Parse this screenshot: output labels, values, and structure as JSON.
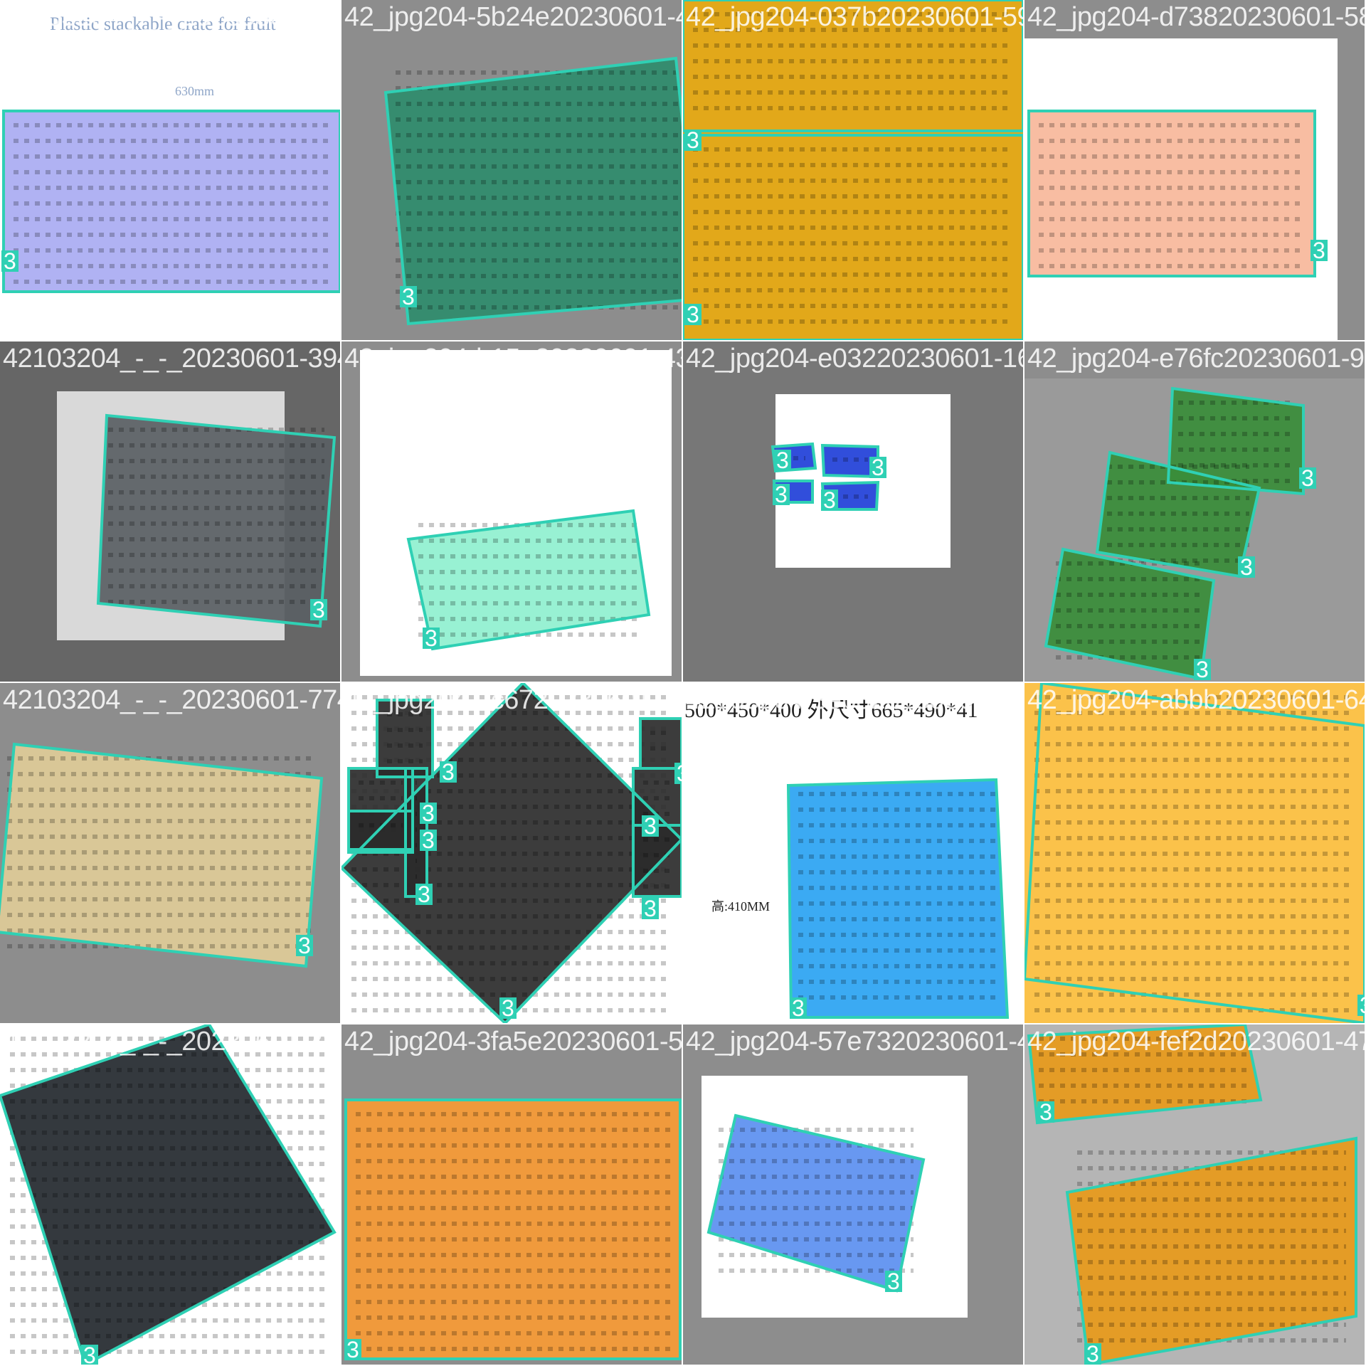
{
  "grid": {
    "rows": 4,
    "cols": 4
  },
  "box_color": "#2fd0b4",
  "tiles": [
    {
      "filename": "42103204_-_-_20230601-1042103204-15b24e",
      "caption": "Plastic stackable crate for fruit",
      "dim": "630mm",
      "crate_color": "#a9abf2",
      "bg": "#ffffff",
      "labels": [
        "3"
      ]
    },
    {
      "filename": "42_jpg204-5b24e20230601-4642103204-037b",
      "crate_color": "#2f8c6d",
      "bg": "#8d8d8d",
      "labels": [
        "3"
      ]
    },
    {
      "filename": "42_jpg204-037b20230601-5942103204-d738",
      "crate_color": "#e2a81a",
      "bg": "#e2a81a",
      "labels": [
        "3",
        "3"
      ]
    },
    {
      "filename": "42_jpg204-d73820230601-58",
      "crate_color": "#f7b79a",
      "bg": "#8d8d8d",
      "labels": [
        "3"
      ]
    },
    {
      "filename": "42103204_-_-_20230601-3942103204-b15e",
      "crate_color": "#5a6064",
      "bg": "#666666",
      "labels": [
        "3"
      ]
    },
    {
      "filename": "42_jpg204-b15e20230601-4342103204-e032",
      "crate_color": "#8ff0cf",
      "bg": "#8d8d8d",
      "labels": [
        "3"
      ]
    },
    {
      "filename": "42_jpg204-e03220230601-1642103204-e76fc",
      "crate_color": "#1f3fd8",
      "bg": "#777777",
      "labels": [
        "3",
        "3",
        "3",
        "3"
      ]
    },
    {
      "filename": "42_jpg204-e76fc20230601-93",
      "crate_color": "#3a8d3a",
      "bg": "#8d8d8d",
      "labels": [
        "3",
        "3",
        "3"
      ]
    },
    {
      "filename": "42103204_-_-_20230601-7742103204-2c67",
      "crate_color": "#e0cc98",
      "bg": "#8d8d8d",
      "labels": [
        "3"
      ]
    },
    {
      "filename": "42_jpg204-2c6720230601-1042103204-3eb8",
      "crate_color": "#2b2b2b",
      "bg": "#ffffff",
      "labels": [
        "3",
        "3",
        "3",
        "3",
        "3",
        "3",
        "3",
        "3"
      ]
    },
    {
      "filename": "42103204-3eb820230601-3542_jpg204-abbb",
      "caption": "500*450*400 外尺寸665*490*41",
      "dim": "高:410MM",
      "crate_color": "#2aa3f2",
      "bg": "#ffffff",
      "labels": [
        "3"
      ]
    },
    {
      "filename": "42_jpg204-abbb20230601-64",
      "crate_color": "#fbc24a",
      "bg": "#fbc24a",
      "labels": [
        "3"
      ]
    },
    {
      "filename": "42103204_-_-_20230601-3842_jpg204-3fa5e",
      "crate_color": "#23282e",
      "bg": "#ffffff",
      "labels": [
        "3"
      ]
    },
    {
      "filename": "42_jpg204-3fa5e20230601-5742103204-57e73",
      "crate_color": "#f89b35",
      "bg": "#8d8d8d",
      "labels": [
        "3"
      ]
    },
    {
      "filename": "42_jpg204-57e7320230601-4742103204-fef2d",
      "crate_color": "#5b8ff0",
      "bg": "#8d8d8d",
      "labels": [
        "3"
      ]
    },
    {
      "filename": "42_jpg204-fef2d20230601-47",
      "crate_color": "#e89a1a",
      "bg": "#b5b5b5",
      "labels": [
        "3",
        "3"
      ]
    }
  ]
}
